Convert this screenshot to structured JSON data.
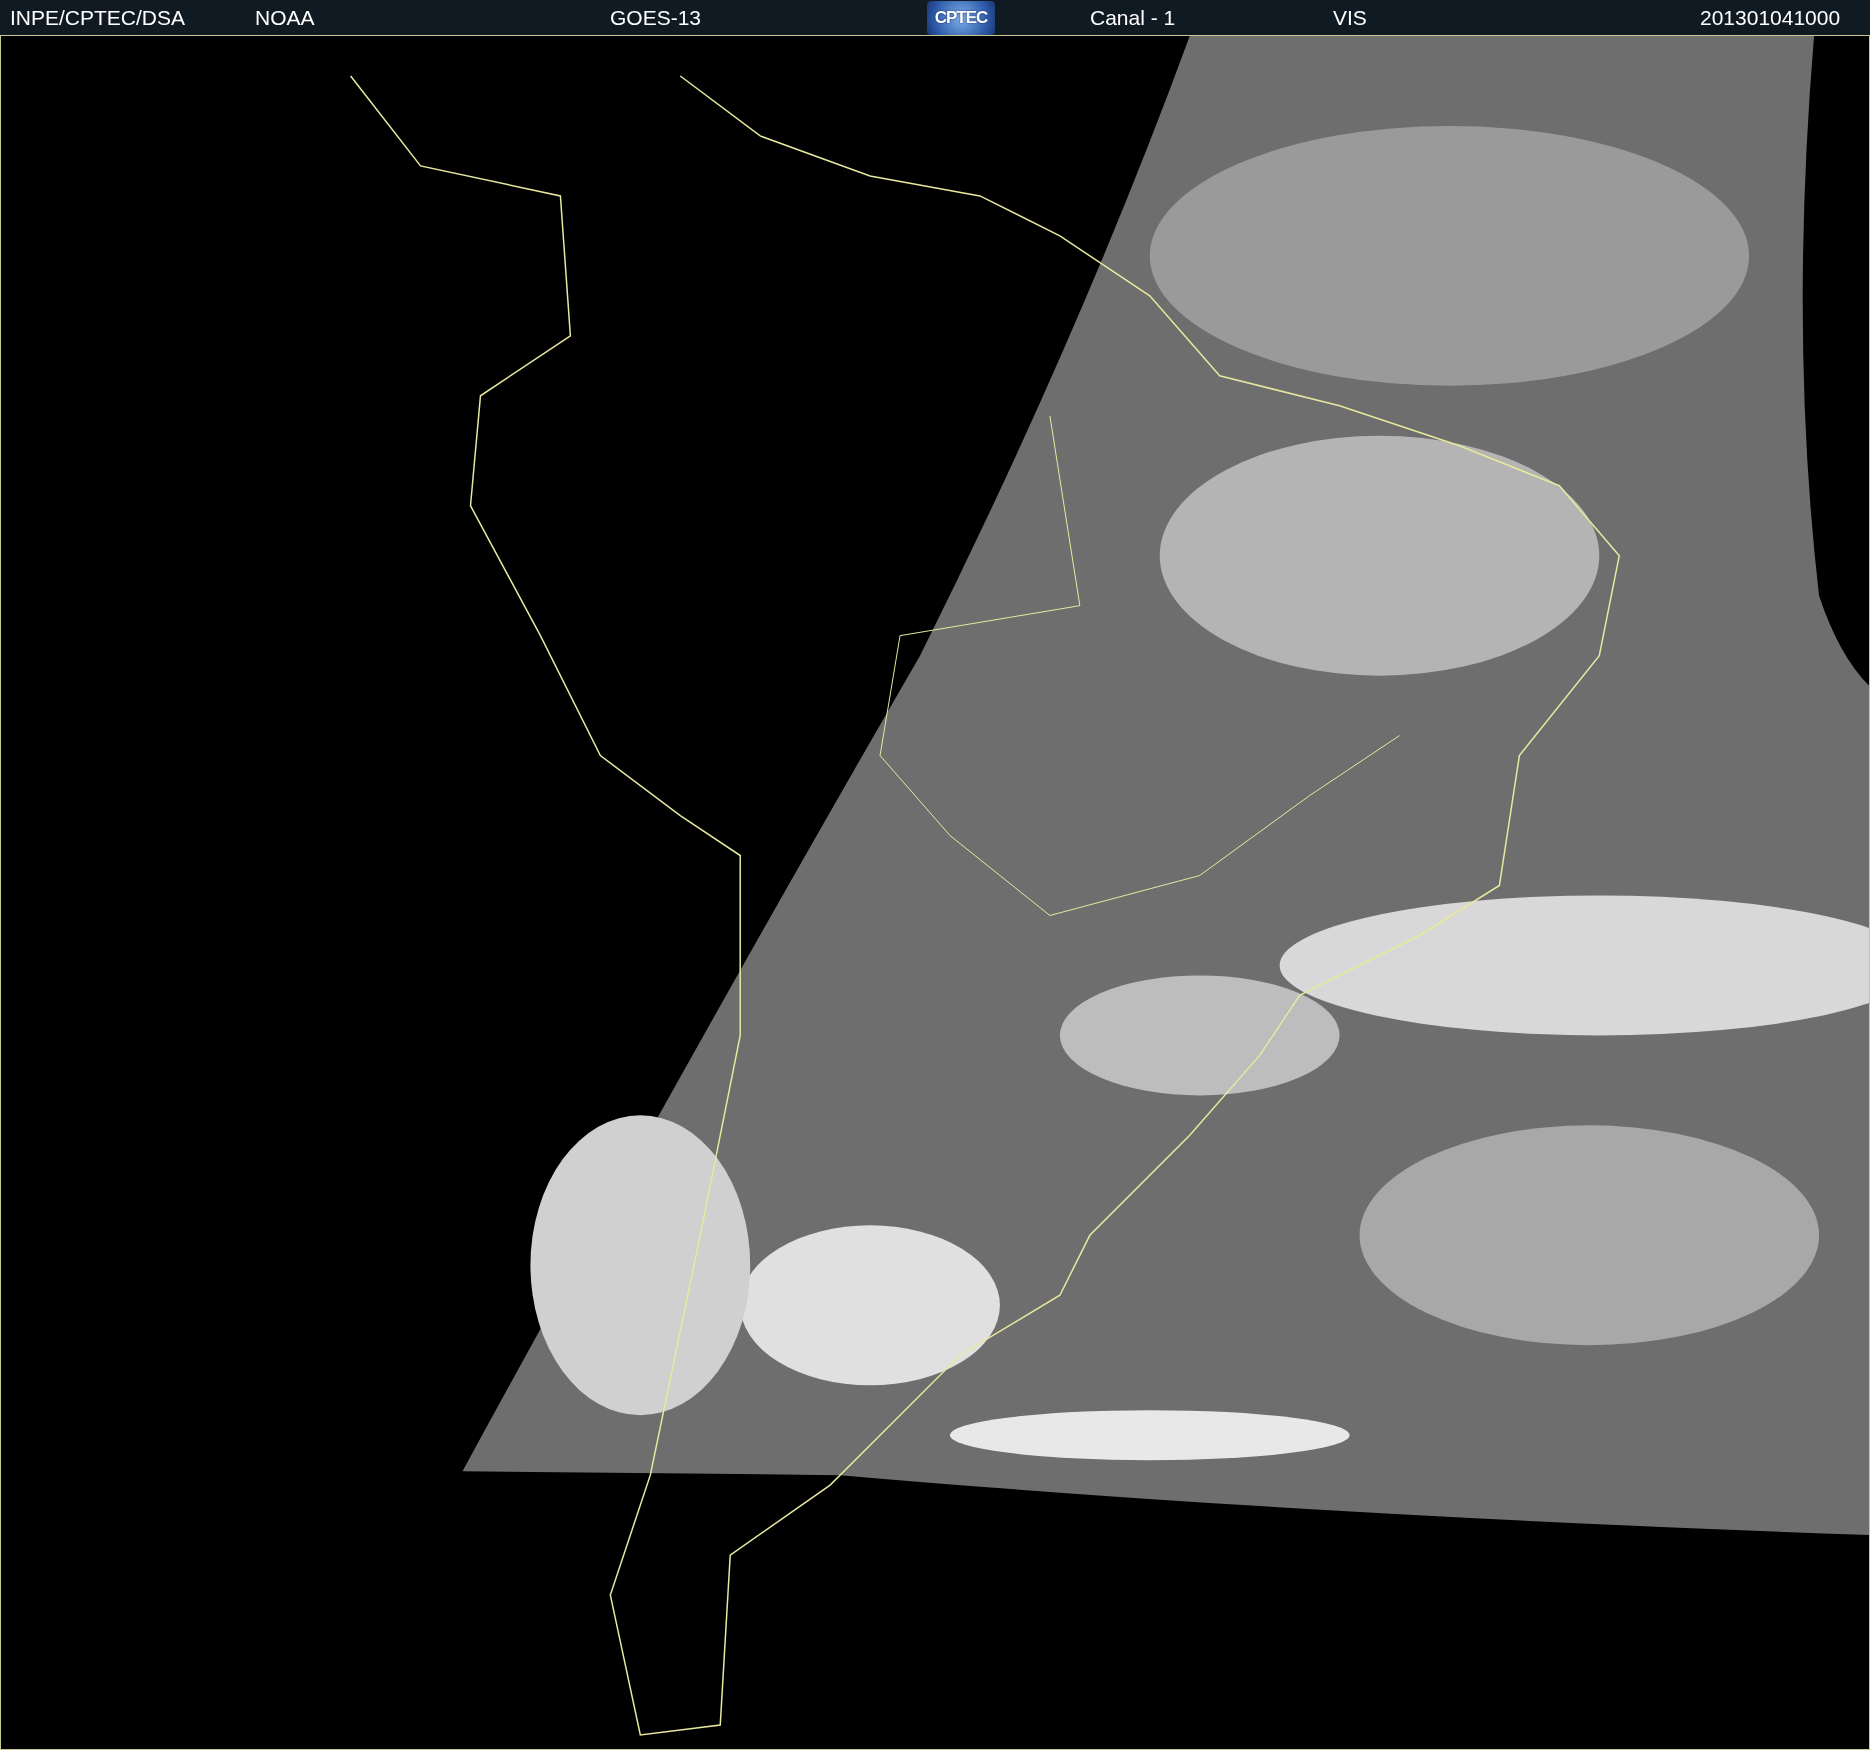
{
  "header": {
    "source": "INPE/CPTEC/DSA",
    "agency": "NOAA",
    "satellite": "GOES-13",
    "logo": "CPTEC",
    "channel": "Canal - 1",
    "band": "VIS",
    "timestamp": "201301041000"
  }
}
